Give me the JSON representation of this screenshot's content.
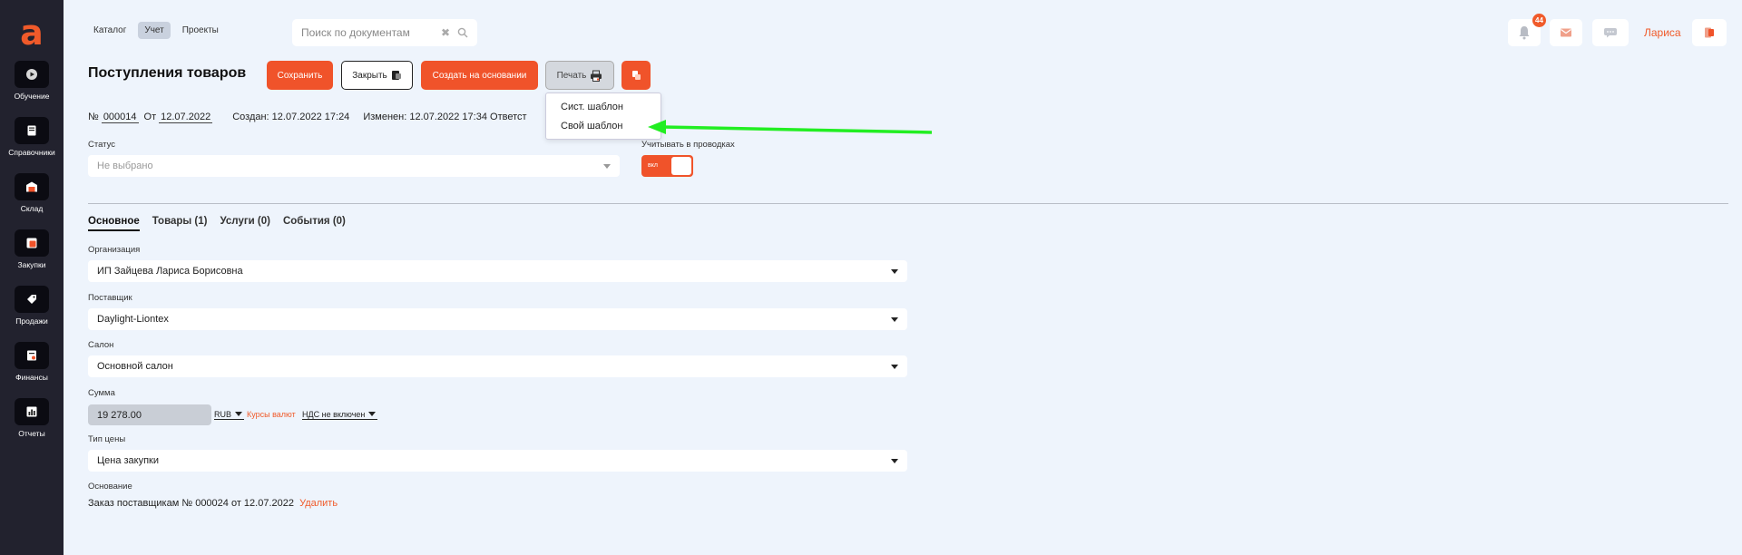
{
  "logo": "a",
  "sidebar": {
    "items": [
      {
        "label": "Обучение",
        "icon": "play-icon"
      },
      {
        "label": "Справочники",
        "icon": "book-icon"
      },
      {
        "label": "Склад",
        "icon": "warehouse-icon"
      },
      {
        "label": "Закупки",
        "icon": "purchases-icon"
      },
      {
        "label": "Продажи",
        "icon": "tag-icon"
      },
      {
        "label": "Финансы",
        "icon": "finance-icon"
      },
      {
        "label": "Отчеты",
        "icon": "chart-icon"
      }
    ]
  },
  "topnav": {
    "items": [
      {
        "label": "Каталог"
      },
      {
        "label": "Учет"
      },
      {
        "label": "Проекты"
      }
    ]
  },
  "search": {
    "placeholder": "Поиск по документам",
    "clear": "✖"
  },
  "header_right": {
    "notifications_count": "44",
    "user_name": "Лариса"
  },
  "page": {
    "title": "Поступления товаров"
  },
  "toolbar": {
    "save": "Сохранить",
    "close": "Закрыть",
    "create_based": "Создать на основании",
    "print": "Печать"
  },
  "print_menu": {
    "items": [
      "Сист. шаблон",
      "Свой шаблон"
    ]
  },
  "meta": {
    "no_label": "№",
    "number": "000014",
    "from_label": "От",
    "date": "12.07.2022",
    "created": "Создан: 12.07.2022 17:24",
    "modified": "Изменен: 12.07.2022 17:34 Ответст"
  },
  "status": {
    "label": "Статус",
    "value": "Не выбрано"
  },
  "posting": {
    "label": "Учитывать в проводках",
    "toggle_text": "вкл"
  },
  "tabs": [
    {
      "label": "Основное"
    },
    {
      "label": "Товары (1)"
    },
    {
      "label": "Услуги (0)"
    },
    {
      "label": "События (0)"
    }
  ],
  "form": {
    "org_label": "Организация",
    "org_value": "ИП Зайцева Лариса Борисовна",
    "supplier_label": "Поставщик",
    "supplier_value": "Daylight-Liontex",
    "salon_label": "Салон",
    "salon_value": "Основной салон",
    "sum_label": "Сумма",
    "sum_value": "19 278.00",
    "currency": "RUB",
    "rates_link": "Курсы валют",
    "vat": "НДС не включен",
    "price_type_label": "Тип цены",
    "price_type_value": "Цена закупки",
    "basis_label": "Основание",
    "basis_value": "Заказ поставщикам № 000024 от 12.07.2022",
    "delete_link": "Удалить"
  },
  "colors": {
    "accent": "#f0532a",
    "sidebar": "#22222e",
    "background": "#eef4fc",
    "annotation_arrow": "#22ee22"
  }
}
